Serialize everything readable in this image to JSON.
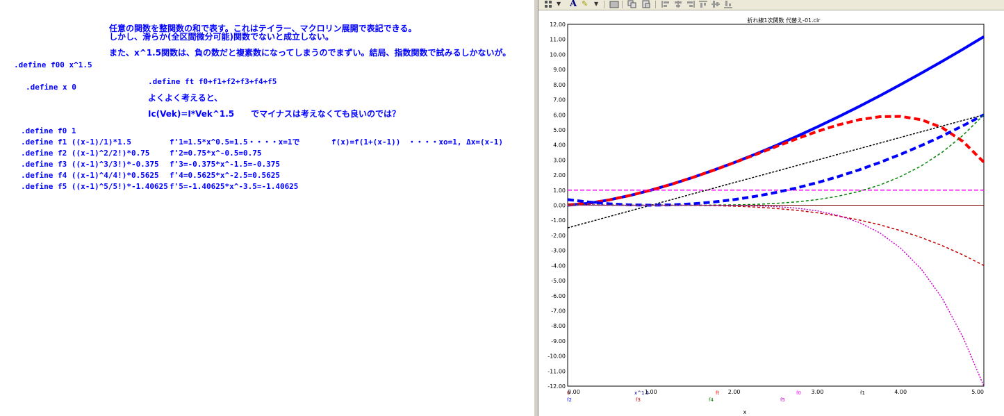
{
  "notes": {
    "line1": "任意の関数を整関数の和で表す。これはテイラー、マクロリン展開で表記できる。",
    "line2": "しかし、滑らか(全区間微分可能)関数でないと成立しない。",
    "line3": "また、x^1.5関数は、負の数だと複素数になってしまうのでまずい。結局、指数関数で試みるしかないが。",
    "define_f00": ".define f00 x^1.5",
    "define_x": ".define x 0",
    "define_ft": ".define ft f0+f1+f2+f3+f4+f5",
    "consider": "よくよく考えると、",
    "ic_formula": "Ic(Vek)=I*Vek^1.5　　でマイナスは考えなくても良いのでは？",
    "define_f0": ".define f0 1",
    "define_f1": ".define f1 ((x-1)/1)*1.5",
    "define_f2": ".define f2 ((x-1)^2/2!)*0.75",
    "define_f3": ".define f3 ((x-1)^3/3!)*-0.375",
    "define_f4": ".define f4 ((x-1)^4/4!)*0.5625",
    "define_f5": ".define f5 ((x-1)^5/5!)*-1.40625",
    "deriv1": "f'1=1.5*x^0.5=1.5・・・・x=1で",
    "deriv2": "f'2=0.75*x^-0.5=0.75",
    "deriv3": "f'3=-0.375*x^-1.5=-0.375",
    "deriv4": "f'4=0.5625*x^-2.5=0.5625",
    "deriv5": "f'5=-1.40625*x^-3.5=-1.40625",
    "taylor": "f(x)=f(1+(x-1))　・・・・xo=1, Δx=(x-1)"
  },
  "toolbar": {
    "font_label": "A"
  },
  "chart_data": {
    "type": "line",
    "title": "折れ線1次関数 代替え-01.cir",
    "xlabel": "x",
    "xlim": [
      0,
      5
    ],
    "ylim": [
      -12,
      12
    ],
    "x_ticks": [
      "0.00",
      "1.00",
      "2.00",
      "3.00",
      "4.00",
      "5.00"
    ],
    "y_ticks": [
      "12.00",
      "11.00",
      "10.00",
      "9.00",
      "8.00",
      "7.00",
      "6.00",
      "5.00",
      "4.00",
      "3.00",
      "2.00",
      "1.00",
      "0.00",
      "-1.00",
      "-2.00",
      "-3.00",
      "-4.00",
      "-5.00",
      "-6.00",
      "-7.00",
      "-8.00",
      "-9.00",
      "-10.00",
      "-11.00",
      "-12.00"
    ],
    "grid": true,
    "legend_entries": [
      {
        "label": "0",
        "color": "#7a0000"
      },
      {
        "label": "x^1.5",
        "color": "#000080"
      },
      {
        "label": "ft",
        "color": "#ff0000"
      },
      {
        "label": "f0",
        "color": "#ff00ff"
      },
      {
        "label": "f1",
        "color": "#000000"
      },
      {
        "label": "f2",
        "color": "#0000ff"
      },
      {
        "label": "f3",
        "color": "#c00000"
      },
      {
        "label": "f4",
        "color": "#008000"
      },
      {
        "label": "f5",
        "color": "#cc00cc"
      }
    ],
    "x": [
      0,
      0.25,
      0.5,
      0.75,
      1,
      1.25,
      1.5,
      1.75,
      2,
      2.25,
      2.5,
      2.75,
      3,
      3.25,
      3.5,
      3.75,
      4,
      4.25,
      4.5,
      4.75,
      5
    ],
    "series": [
      {
        "name": "0",
        "color": "#7a0000",
        "width": 1,
        "dash": "",
        "values": [
          0,
          0,
          0,
          0,
          0,
          0,
          0,
          0,
          0,
          0,
          0,
          0,
          0,
          0,
          0,
          0,
          0,
          0,
          0,
          0,
          0
        ]
      },
      {
        "name": "x^1.5",
        "color": "#0000ff",
        "width": 4,
        "dash": "",
        "values": [
          0,
          0.125,
          0.354,
          0.65,
          1,
          1.398,
          1.837,
          2.315,
          2.828,
          3.375,
          3.953,
          4.56,
          5.196,
          5.859,
          6.548,
          7.262,
          8,
          8.761,
          9.546,
          10.352,
          11.18
        ]
      },
      {
        "name": "ft",
        "color": "#ff0000",
        "width": 4,
        "dash": "9,5",
        "values": [
          0.023,
          0.127,
          0.354,
          0.65,
          1,
          1.398,
          1.838,
          2.314,
          2.82,
          3.346,
          3.88,
          4.405,
          4.898,
          5.331,
          5.67,
          5.874,
          5.893,
          5.671,
          5.142,
          4.231,
          2.852
        ]
      },
      {
        "name": "f0",
        "color": "#ff00ff",
        "width": 1.5,
        "dash": "6,3",
        "values": [
          1,
          1,
          1,
          1,
          1,
          1,
          1,
          1,
          1,
          1,
          1,
          1,
          1,
          1,
          1,
          1,
          1,
          1,
          1,
          1,
          1
        ]
      },
      {
        "name": "f1",
        "color": "#000000",
        "width": 1.5,
        "dash": "3,2",
        "values": [
          -1.5,
          -1.125,
          -0.75,
          -0.375,
          0,
          0.375,
          0.75,
          1.125,
          1.5,
          1.875,
          2.25,
          2.625,
          3,
          3.375,
          3.75,
          4.125,
          4.5,
          4.875,
          5.25,
          5.625,
          6
        ]
      },
      {
        "name": "f2",
        "color": "#0000ff",
        "width": 4,
        "dash": "9,5",
        "values": [
          0.375,
          0.211,
          0.094,
          0.023,
          0,
          0.023,
          0.094,
          0.211,
          0.375,
          0.586,
          0.844,
          1.148,
          1.5,
          1.898,
          2.344,
          2.836,
          3.375,
          3.961,
          4.594,
          5.273,
          6
        ]
      },
      {
        "name": "f3",
        "color": "#c00000",
        "width": 1.5,
        "dash": "4,3",
        "values": [
          0.0625,
          0.026,
          0.008,
          0.001,
          0,
          -0.001,
          -0.008,
          -0.026,
          -0.0625,
          -0.122,
          -0.211,
          -0.335,
          -0.5,
          -0.712,
          -0.977,
          -1.3,
          -1.6875,
          -2.146,
          -2.68,
          -3.296,
          -4
        ]
      },
      {
        "name": "f4",
        "color": "#008000",
        "width": 1.5,
        "dash": "4,3",
        "values": [
          0.023,
          0.007,
          0.001,
          0,
          0,
          0,
          0.001,
          0.007,
          0.023,
          0.057,
          0.119,
          0.22,
          0.375,
          0.601,
          0.916,
          1.341,
          1.898,
          2.614,
          3.517,
          4.638,
          6
        ]
      },
      {
        "name": "f5",
        "color": "#cc00cc",
        "width": 1.5,
        "dash": "2,2",
        "values": [
          0.0117,
          0.003,
          0.0004,
          0,
          0,
          0,
          -0.0004,
          -0.003,
          -0.0117,
          -0.036,
          -0.089,
          -0.192,
          -0.375,
          -0.676,
          -1.139,
          -1.834,
          -2.848,
          -4.241,
          -6.175,
          -8.759,
          -12
        ]
      }
    ]
  }
}
